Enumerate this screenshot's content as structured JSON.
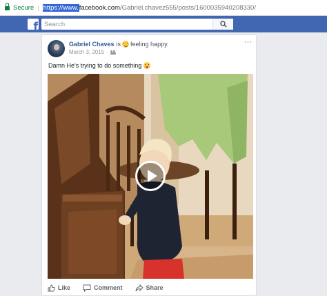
{
  "browser": {
    "secure_label": "Secure",
    "separator": "|",
    "url_scheme": "https://www.",
    "url_host": "facebook.com",
    "url_path": "/Gabriel.chavez555/posts/1600035940208330/"
  },
  "fb": {
    "logo": "f",
    "search_placeholder": "Search",
    "brand_color": "#4267b2"
  },
  "post": {
    "author": "Gabriel Chaves",
    "is_label": "is",
    "feeling": "feeling happy.",
    "date": "March 3, 2015",
    "date_separator": "·",
    "audience_icon": "friends-icon",
    "more_label": "···",
    "message": "Damn He's trying to do something",
    "video": {
      "play_icon": "play-icon"
    }
  },
  "actions": {
    "like": "Like",
    "comment": "Comment",
    "share": "Share"
  }
}
